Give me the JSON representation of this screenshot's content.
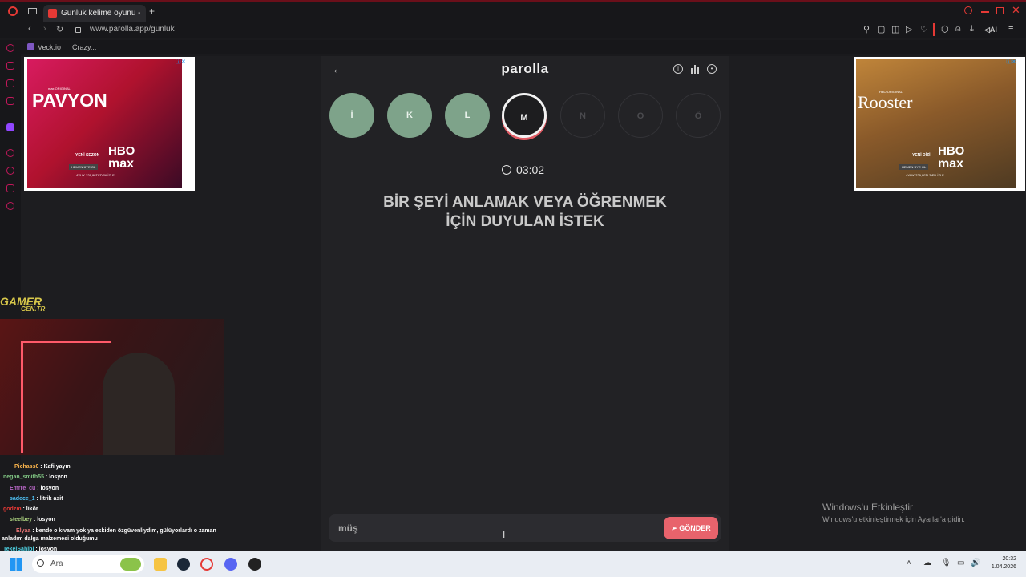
{
  "browser": {
    "tab_title": "Günlük kelime oyunu - par",
    "url": "www.parolla.app/gunluk",
    "bookmarks": [
      "Veck.io",
      "Crazy..."
    ]
  },
  "app": {
    "title": "parolla",
    "letters": [
      {
        "letter": "İ",
        "state": "done"
      },
      {
        "letter": "K",
        "state": "done"
      },
      {
        "letter": "L",
        "state": "done"
      },
      {
        "letter": "M",
        "state": "current"
      },
      {
        "letter": "N",
        "state": "todo"
      },
      {
        "letter": "O",
        "state": "todo"
      },
      {
        "letter": "Ö",
        "state": "todo"
      }
    ],
    "timer": "03:02",
    "question_line1": "BİR ŞEYİ ANLAMAK VEYA ÖĞRENMEK",
    "question_line2": "İÇİN DUYULAN İSTEK",
    "answer_value": "müş",
    "send_label": "GÖNDER"
  },
  "ads": {
    "left": {
      "brand_top": "max ORIGINAL",
      "brand": "PAVYON",
      "season": "YENİ SEZON",
      "hbo1": "HBO",
      "hbo2": "max",
      "cta": "HEMEN ÜYE OL",
      "price": "AYLIK 229,90TL'DEN İZLE"
    },
    "right": {
      "brand_top": "HBO ORIGINAL",
      "brand": "Rooster",
      "season": "YENİ DİZİ",
      "hbo1": "HBO",
      "hbo2": "max",
      "cta": "HEMEN ÜYE OL",
      "price": "AYLIK 229,90TL'DEN İZLE"
    }
  },
  "overlay": {
    "watermark1": "GAMER",
    "watermark2": "GEN.TR",
    "chat": [
      {
        "user": "Pichass0",
        "msg": "Kafi yayın",
        "color": "#ffb74d"
      },
      {
        "user": "negan_smith55",
        "msg": "losyon",
        "color": "#81c784"
      },
      {
        "user": "Emrre_cu",
        "msg": "losyon",
        "color": "#ba68c8"
      },
      {
        "user": "sadece_1",
        "msg": "litrik asit",
        "color": "#4fc3f7"
      },
      {
        "user": "godzm",
        "msg": "likör",
        "color": "#e53935"
      },
      {
        "user": "steelbey",
        "msg": "losyon",
        "color": "#aed581"
      },
      {
        "user": "Elyaa",
        "msg": "bende o kıvam yok ya eskiden özgüvenliydim, gülüyorlardı o zaman",
        "color": "#e57373"
      },
      {
        "user": "",
        "msg": "anladım dalga malzemesi olduğumu",
        "color": "#ffffff"
      },
      {
        "user": "TekelSahibi",
        "msg": "losyon",
        "color": "#4dd0e1"
      }
    ]
  },
  "windows": {
    "activate_title": "Windows'u Etkinleştir",
    "activate_sub": "Windows'u etkinleştirmek için Ayarlar'a gidin.",
    "search_placeholder": "Ara",
    "time": "20:32",
    "date": "1.04.2026"
  },
  "colors": {
    "accent": "#e8636c",
    "done": "#7ea38a",
    "bg": "#222225"
  }
}
